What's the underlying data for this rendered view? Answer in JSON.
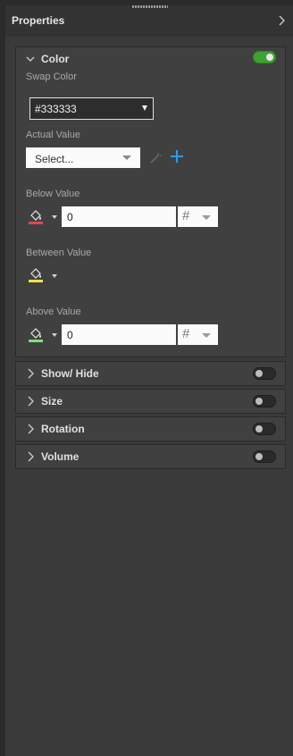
{
  "header": {
    "title": "Properties"
  },
  "color_section": {
    "title": "Color",
    "enabled": true,
    "swap_color": {
      "label": "Swap Color",
      "value": "#333333"
    },
    "actual_value": {
      "label": "Actual Value",
      "placeholder": "Select..."
    },
    "below_value": {
      "label": "Below Value",
      "color": "#e0474c",
      "value": "0",
      "unit": "#"
    },
    "between_value": {
      "label": "Between Value",
      "color": "#f0e14a"
    },
    "above_value": {
      "label": "Above Value",
      "color": "#7ee07a",
      "value": "0",
      "unit": "#"
    }
  },
  "sections": [
    {
      "title": "Show/ Hide",
      "enabled": false
    },
    {
      "title": "Size",
      "enabled": false
    },
    {
      "title": "Rotation",
      "enabled": false
    },
    {
      "title": "Volume",
      "enabled": false
    }
  ],
  "colors": {
    "accent_toggle": "#3da133",
    "add_icon": "#2b9de9"
  }
}
